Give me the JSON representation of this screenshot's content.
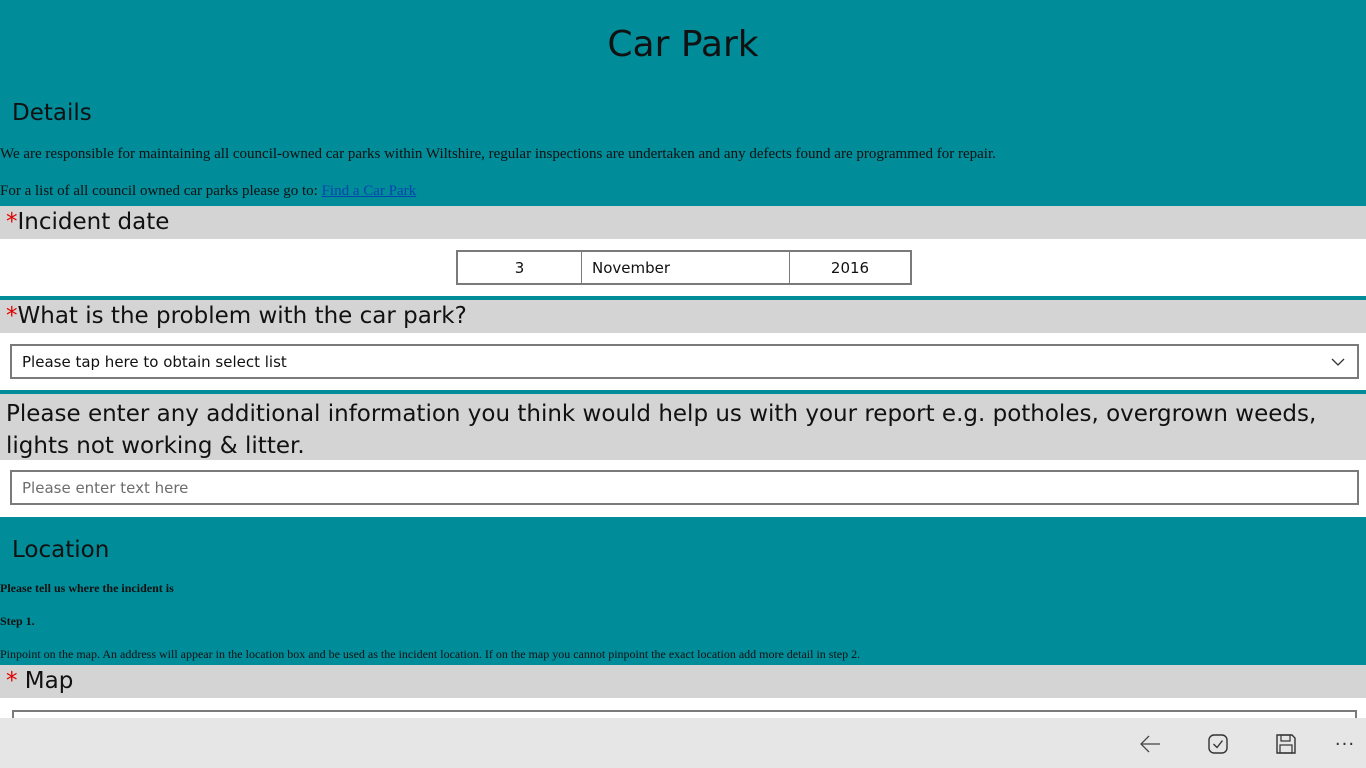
{
  "page": {
    "title": "Car Park"
  },
  "details": {
    "heading": "Details",
    "paragraph": "We are responsible for maintaining all council-owned car parks within Wiltshire, regular inspections are undertaken and any defects found are programmed for repair.",
    "list_prefix": "For a list of all council owned car parks please go to: ",
    "list_link": "Find a Car Park"
  },
  "incident_date": {
    "required_mark": "*",
    "label": "Incident date",
    "day": "3",
    "month": "November",
    "year": "2016"
  },
  "problem": {
    "required_mark": "*",
    "label": "What is the problem with the car park?",
    "selected": "Please tap here to obtain select list"
  },
  "additional_info": {
    "label": "Please enter any additional information you think would help us with your report e.g. potholes, overgrown weeds, lights not working & litter.",
    "placeholder": "Please enter text here"
  },
  "location": {
    "heading": "Location",
    "intro": "Please tell us where the incident is",
    "step": "Step 1.",
    "instructions": "Pinpoint on the map.  An address will appear in the location box and be used as the incident location.  If on the map you cannot pinpoint the exact location add more detail in step 2."
  },
  "map": {
    "required_mark": "*",
    "label": " Map"
  },
  "app_bar": {
    "icons": [
      "back-arrow-icon",
      "check-circle-icon",
      "save-icon",
      "more-icon"
    ],
    "more_label": "···"
  },
  "colors": {
    "background": "#008c99",
    "section_bar": "#d4d4d4",
    "required": "#e00000",
    "app_bar": "#e6e6e6"
  }
}
